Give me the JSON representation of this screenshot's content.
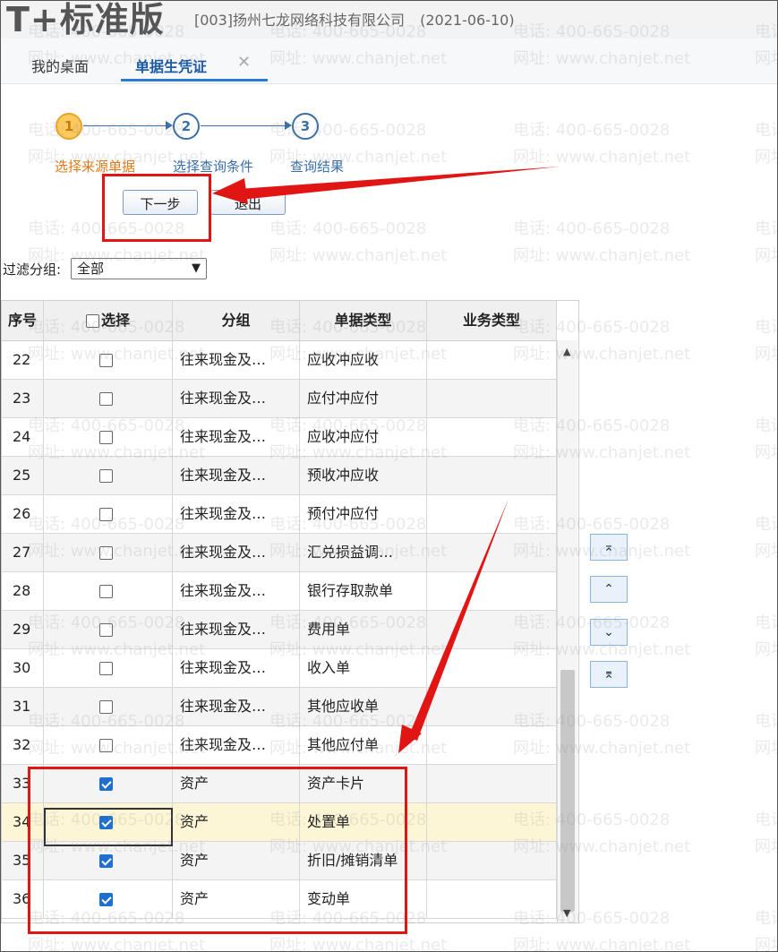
{
  "header": {
    "logo": "T+标准版",
    "company": "[003]扬州七龙网络科技有限公司",
    "date": "(2021-06-10)"
  },
  "tabs": [
    {
      "label": "我的桌面"
    },
    {
      "label": "单据生凭证"
    }
  ],
  "stepper": {
    "steps": [
      {
        "num": "1",
        "label": "选择来源单据"
      },
      {
        "num": "2",
        "label": "选择查询条件"
      },
      {
        "num": "3",
        "label": "查询结果"
      }
    ]
  },
  "buttons": {
    "next": "下一步",
    "exit": "退出"
  },
  "filter": {
    "label": "过滤分组:",
    "value": "全部"
  },
  "grid": {
    "headers": [
      "序号",
      "选择",
      "分组",
      "单据类型",
      "业务类型"
    ],
    "rows": [
      {
        "no": "22",
        "checked": false,
        "group": "往来现金及…",
        "type": "应收冲应收",
        "biz": ""
      },
      {
        "no": "23",
        "checked": false,
        "group": "往来现金及…",
        "type": "应付冲应付",
        "biz": ""
      },
      {
        "no": "24",
        "checked": false,
        "group": "往来现金及…",
        "type": "应收冲应付",
        "biz": ""
      },
      {
        "no": "25",
        "checked": false,
        "group": "往来现金及…",
        "type": "预收冲应收",
        "biz": ""
      },
      {
        "no": "26",
        "checked": false,
        "group": "往来现金及…",
        "type": "预付冲应付",
        "biz": ""
      },
      {
        "no": "27",
        "checked": false,
        "group": "往来现金及…",
        "type": "汇兑损益调…",
        "biz": ""
      },
      {
        "no": "28",
        "checked": false,
        "group": "往来现金及…",
        "type": "银行存取款单",
        "biz": ""
      },
      {
        "no": "29",
        "checked": false,
        "group": "往来现金及…",
        "type": "费用单",
        "biz": ""
      },
      {
        "no": "30",
        "checked": false,
        "group": "往来现金及…",
        "type": "收入单",
        "biz": ""
      },
      {
        "no": "31",
        "checked": false,
        "group": "往来现金及…",
        "type": "其他应收单",
        "biz": ""
      },
      {
        "no": "32",
        "checked": false,
        "group": "往来现金及…",
        "type": "其他应付单",
        "biz": ""
      },
      {
        "no": "33",
        "checked": true,
        "group": "资产",
        "type": "资产卡片",
        "biz": ""
      },
      {
        "no": "34",
        "checked": true,
        "group": "资产",
        "type": "处置单",
        "biz": ""
      },
      {
        "no": "35",
        "checked": true,
        "group": "资产",
        "type": "折旧/摊销清单",
        "biz": ""
      },
      {
        "no": "36",
        "checked": true,
        "group": "资产",
        "type": "变动单",
        "biz": ""
      }
    ]
  },
  "move_buttons": {
    "top": "⌅",
    "up": "⌃",
    "down": "⌄",
    "bottom": "⌆"
  },
  "watermark": {
    "phone": "电话: 400-665-0028",
    "site": "网址: www.chanjet.net"
  },
  "colors": {
    "accent": "#1a5aa6",
    "active_step": "#e07a18",
    "annotation": "#e21515",
    "checkbox": "#1f6fd1",
    "selected_row": "#fdf6d6"
  }
}
